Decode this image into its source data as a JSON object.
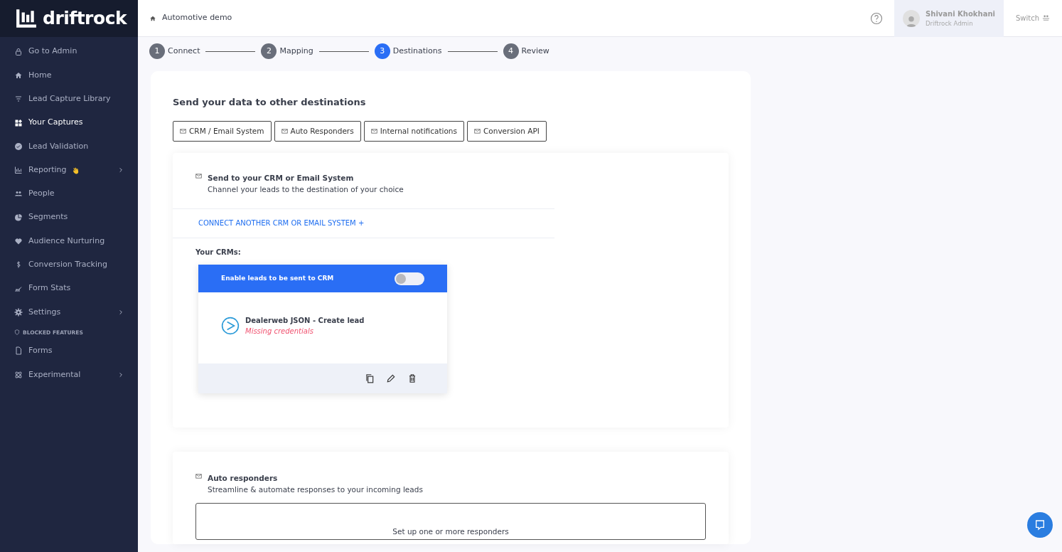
{
  "brand": {
    "name": "driftrock"
  },
  "sidebar": {
    "items": [
      {
        "kind": "link",
        "label": "Go to Admin",
        "selected": false,
        "expandable": false,
        "wave": false
      },
      {
        "kind": "link",
        "label": "Home",
        "selected": false,
        "expandable": false,
        "wave": false
      },
      {
        "kind": "link",
        "label": "Lead Capture Library",
        "selected": false,
        "expandable": false,
        "wave": false
      },
      {
        "kind": "link",
        "label": "Your Captures",
        "selected": true,
        "expandable": false,
        "wave": false
      },
      {
        "kind": "link",
        "label": "Lead Validation",
        "selected": false,
        "expandable": false,
        "wave": false
      },
      {
        "kind": "link",
        "label": "Reporting",
        "selected": false,
        "expandable": true,
        "wave": true
      },
      {
        "kind": "link",
        "label": "People",
        "selected": false,
        "expandable": false,
        "wave": false
      },
      {
        "kind": "link",
        "label": "Segments",
        "selected": false,
        "expandable": false,
        "wave": false
      },
      {
        "kind": "link",
        "label": "Audience Nurturing",
        "selected": false,
        "expandable": false,
        "wave": false
      },
      {
        "kind": "link",
        "label": "Conversion Tracking",
        "selected": false,
        "expandable": false,
        "wave": false
      },
      {
        "kind": "link",
        "label": "Form Stats",
        "selected": false,
        "expandable": false,
        "wave": false
      },
      {
        "kind": "link",
        "label": "Settings",
        "selected": false,
        "expandable": true,
        "wave": false
      },
      {
        "kind": "section",
        "label": "BLOCKED FEATURES"
      },
      {
        "kind": "link",
        "label": "Forms",
        "selected": false,
        "expandable": false,
        "wave": false
      },
      {
        "kind": "link",
        "label": "Experimental",
        "selected": false,
        "expandable": true,
        "wave": false
      }
    ]
  },
  "topbar": {
    "breadcrumb": "Automotive demo",
    "user": {
      "name": "Shivani Khokhani",
      "role": "Driftrock Admin"
    },
    "switch": "Switch"
  },
  "stepper": [
    {
      "number": "1",
      "label": "Connect",
      "selected": false
    },
    {
      "number": "2",
      "label": "Mapping",
      "selected": false
    },
    {
      "number": "3",
      "label": "Destinations",
      "selected": true
    },
    {
      "number": "4",
      "label": "Review",
      "selected": false
    }
  ],
  "main": {
    "title": "Send your data to other destinations",
    "tabs": [
      "CRM / Email System",
      "Auto Responders",
      "Internal notifications",
      "Conversion API"
    ],
    "crm_section": {
      "title": "Send to your CRM or Email System",
      "subtitle": "Channel your leads to the destination of your choice",
      "connect_link": "CONNECT ANOTHER CRM OR EMAIL SYSTEM",
      "connect_plus": "+",
      "list_label": "Your CRMs:",
      "crm": {
        "toggle_label": "Enable leads to be sent to CRM",
        "on": false,
        "name": "Dealerweb JSON - Create lead",
        "status": "Missing credentials"
      }
    },
    "auto_section": {
      "title": "Auto responders",
      "subtitle": "Streamline & automate responses to your incoming leads",
      "empty_text": "Set up one or more responders"
    }
  }
}
